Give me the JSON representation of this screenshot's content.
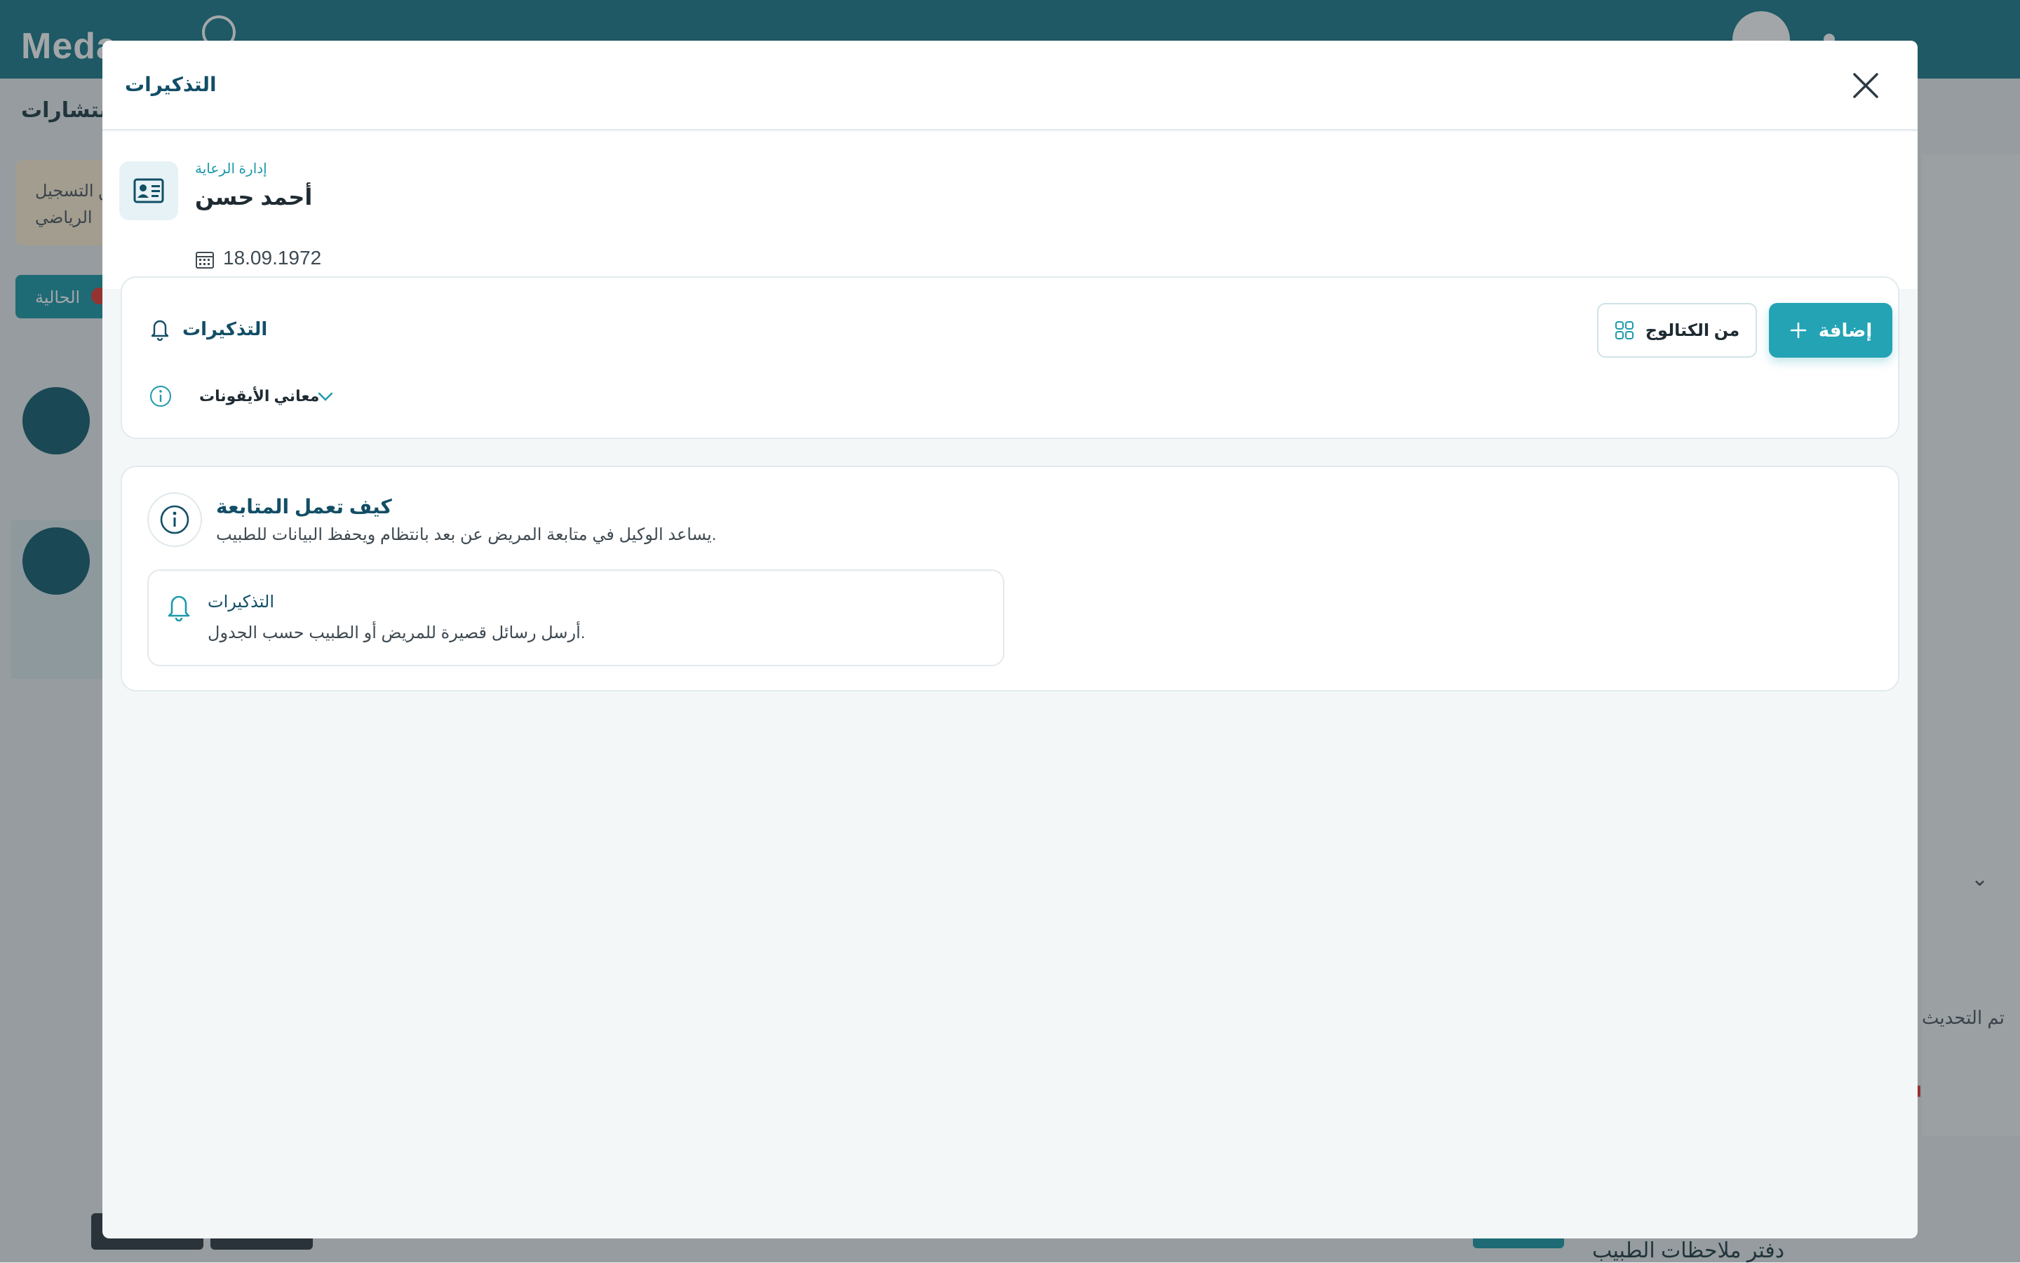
{
  "background": {
    "logo_text": "Meda",
    "nav_text": "الاستشارات",
    "warning_line1": "تحقق التسجيل",
    "warning_line2": "الرياضي",
    "tab_label": "الحالية",
    "right_text": "تم التحديث",
    "bottom_text": "دفتر ملاحظات الطبيب"
  },
  "modal": {
    "title": "التذكيرات",
    "close_icon": "close-icon"
  },
  "patient": {
    "care_label": "إدارة الرعاية",
    "name": "أحمد حسن",
    "dob": "18.09.1972",
    "icon": "id-card-icon"
  },
  "reminders_card": {
    "title": "التذكيرات",
    "title_icon": "bell-icon",
    "icon_meanings_label": "معاني الأيقونات",
    "catalog_button": "من الكتالوج",
    "add_button": "إضافة"
  },
  "how_it_works": {
    "title": "كيف تعمل المتابعة",
    "description": "يساعد الوكيل في متابعة المريض عن بعد بانتظام ويحفظ البيانات للطبيب.",
    "feature": {
      "title": "التذكيرات",
      "description": "أرسل رسائل قصيرة للمريض أو الطبيب حسب الجدول."
    }
  },
  "colors": {
    "brand_teal": "#1b7a8c",
    "accent": "#23a3b3",
    "title_dark": "#124e66"
  }
}
